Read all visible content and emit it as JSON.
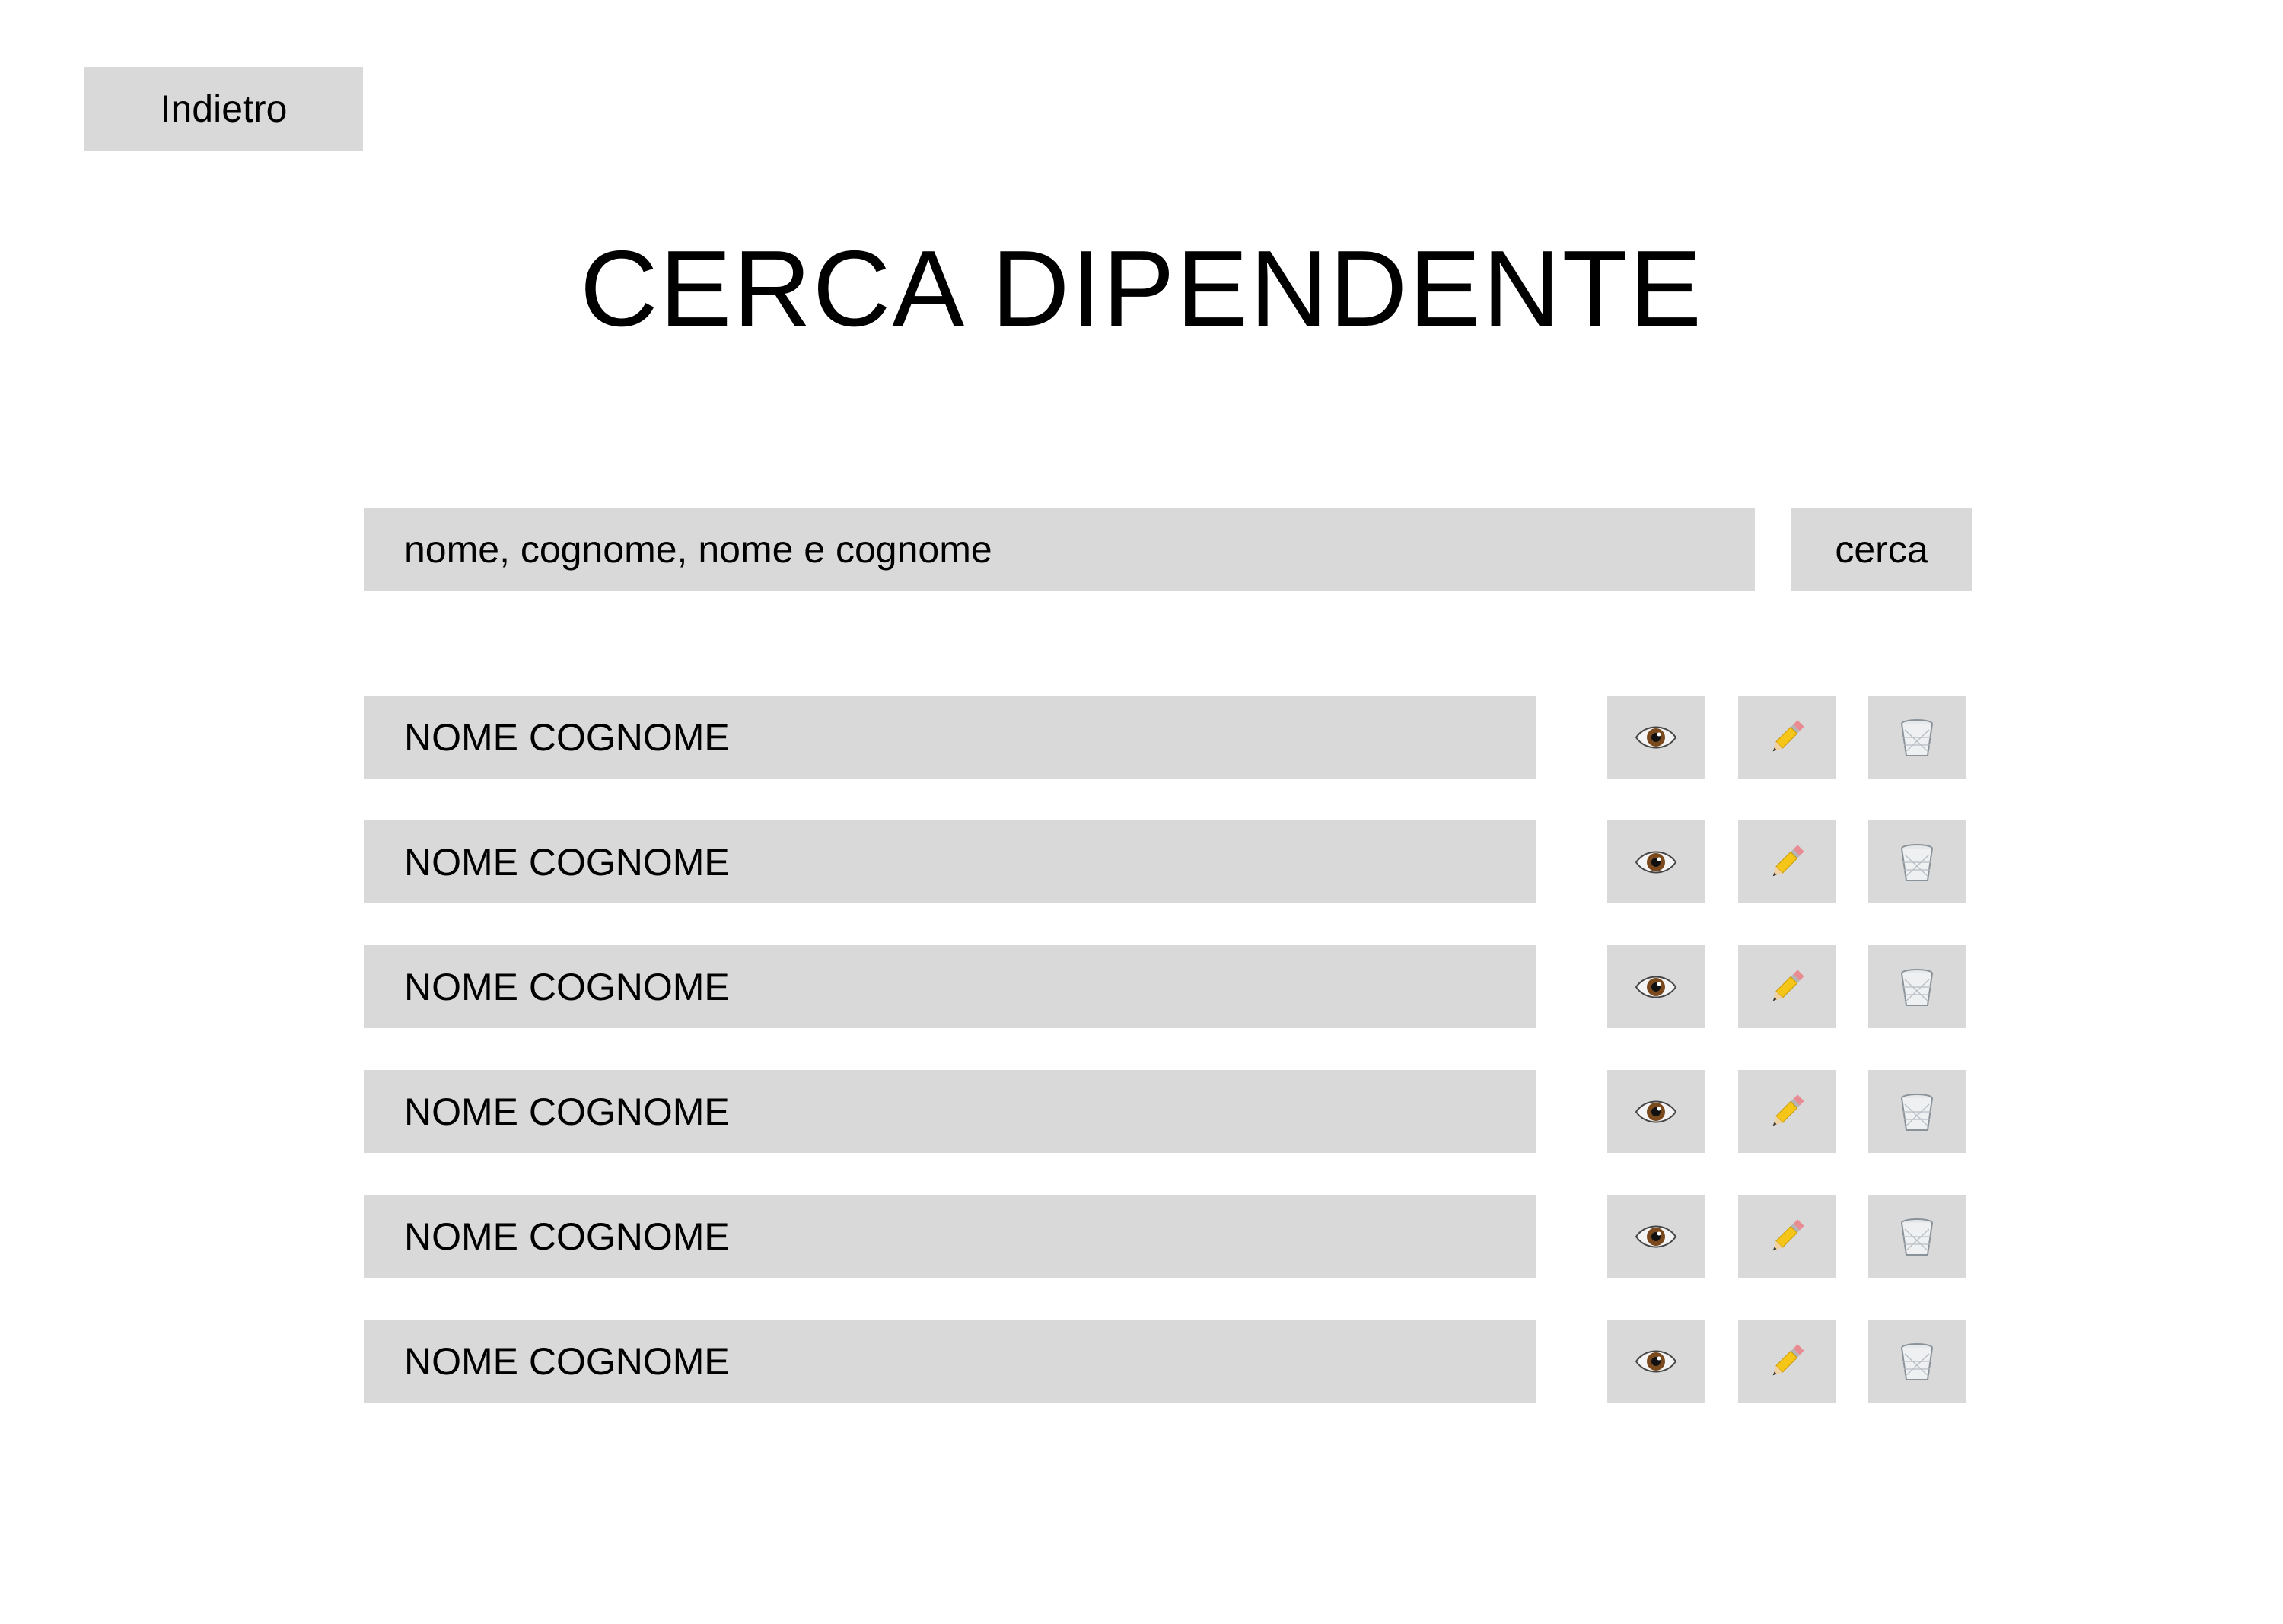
{
  "header": {
    "back_label": "Indietro",
    "title": "CERCA DIPENDENTE"
  },
  "search": {
    "placeholder": "nome, cognome, nome e cognome",
    "button_label": "cerca"
  },
  "employees": [
    {
      "name": "NOME COGNOME"
    },
    {
      "name": "NOME COGNOME"
    },
    {
      "name": "NOME COGNOME"
    },
    {
      "name": "NOME COGNOME"
    },
    {
      "name": "NOME COGNOME"
    },
    {
      "name": "NOME COGNOME"
    }
  ],
  "row_actions": [
    {
      "icon": "eye-icon"
    },
    {
      "icon": "pencil-icon"
    },
    {
      "icon": "trash-icon"
    }
  ],
  "colors": {
    "background": "#ffffff",
    "panel": "#d9d9d9",
    "text": "#000000"
  }
}
